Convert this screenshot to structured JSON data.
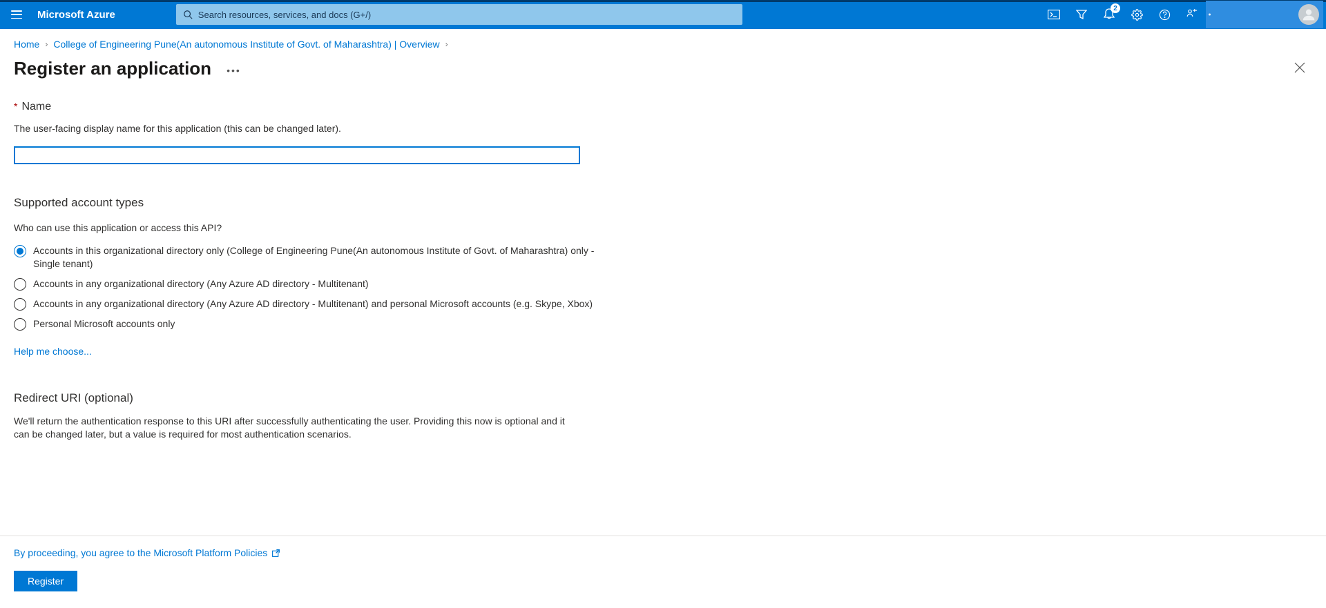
{
  "header": {
    "brand": "Microsoft Azure",
    "search_placeholder": "Search resources, services, and docs (G+/)",
    "notifications_badge": "2"
  },
  "breadcrumbs": {
    "home": "Home",
    "org": "College of Engineering Pune(An autonomous Institute of Govt. of Maharashtra) | Overview"
  },
  "page": {
    "title": "Register an application"
  },
  "name_section": {
    "label": "Name",
    "description": "The user-facing display name for this application (this can be changed later).",
    "value": ""
  },
  "account_types": {
    "heading": "Supported account types",
    "question": "Who can use this application or access this API?",
    "options": [
      "Accounts in this organizational directory only (College of Engineering Pune(An autonomous Institute of Govt. of Maharashtra) only - Single tenant)",
      "Accounts in any organizational directory (Any Azure AD directory - Multitenant)",
      "Accounts in any organizational directory (Any Azure AD directory - Multitenant) and personal Microsoft accounts (e.g. Skype, Xbox)",
      "Personal Microsoft accounts only"
    ],
    "help_link": "Help me choose..."
  },
  "redirect": {
    "heading": "Redirect URI (optional)",
    "description": "We'll return the authentication response to this URI after successfully authenticating the user. Providing this now is optional and it can be changed later, but a value is required for most authentication scenarios."
  },
  "footer": {
    "policies": "By proceeding, you agree to the Microsoft Platform Policies",
    "register": "Register"
  }
}
